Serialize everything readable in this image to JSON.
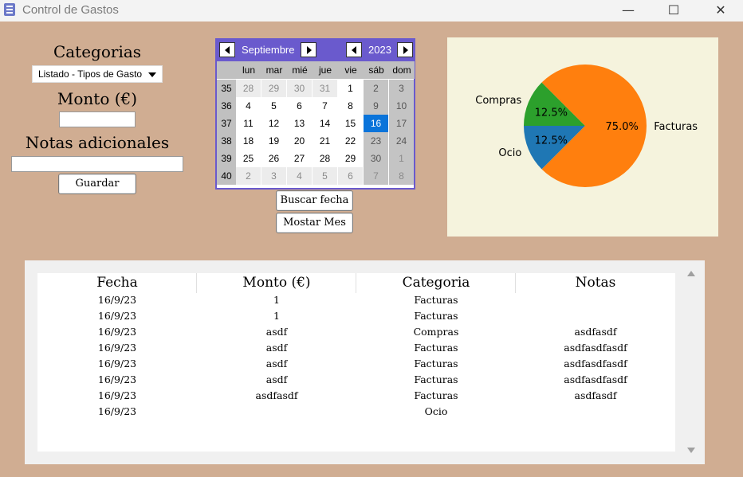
{
  "window": {
    "title": "Control de Gastos",
    "minimize": "—",
    "maximize": "☐",
    "close": "✕"
  },
  "form": {
    "category_label": "Categorias",
    "category_select": "Listado - Tipos de Gasto",
    "amount_label": "Monto (€)",
    "amount_value": "",
    "notes_label": "Notas adicionales",
    "notes_value": "",
    "save_button": "Guardar"
  },
  "calendar": {
    "month": "Septiembre",
    "year": "2023",
    "weekdays": [
      "lun",
      "mar",
      "mié",
      "jue",
      "vie",
      "sáb",
      "dom"
    ],
    "weeks": [
      {
        "num": "35",
        "days": [
          "28",
          "29",
          "30",
          "31",
          "1",
          "2",
          "3"
        ]
      },
      {
        "num": "36",
        "days": [
          "4",
          "5",
          "6",
          "7",
          "8",
          "9",
          "10"
        ]
      },
      {
        "num": "37",
        "days": [
          "11",
          "12",
          "13",
          "14",
          "15",
          "16",
          "17"
        ]
      },
      {
        "num": "38",
        "days": [
          "18",
          "19",
          "20",
          "21",
          "22",
          "23",
          "24"
        ]
      },
      {
        "num": "39",
        "days": [
          "25",
          "26",
          "27",
          "28",
          "29",
          "30",
          "1"
        ]
      },
      {
        "num": "40",
        "days": [
          "2",
          "3",
          "4",
          "5",
          "6",
          "7",
          "8"
        ]
      }
    ],
    "selected_day": "16",
    "search_button": "Buscar fecha",
    "month_button": "Mostar Mes"
  },
  "chart_data": {
    "type": "pie",
    "slices": [
      {
        "label": "Facturas",
        "percent": 75.0,
        "pct_label": "75.0%",
        "color": "#ff7f0e"
      },
      {
        "label": "Ocio",
        "percent": 12.5,
        "pct_label": "12.5%",
        "color": "#1f77b4"
      },
      {
        "label": "Compras",
        "percent": 12.5,
        "pct_label": "12.5%",
        "color": "#2ca02c"
      }
    ]
  },
  "table": {
    "columns": [
      "Fecha",
      "Monto (€)",
      "Categoria",
      "Notas"
    ],
    "rows": [
      [
        "16/9/23",
        "1",
        "Facturas",
        ""
      ],
      [
        "16/9/23",
        "1",
        "Facturas",
        ""
      ],
      [
        "16/9/23",
        "asdf",
        "Compras",
        "asdfasdf"
      ],
      [
        "16/9/23",
        "asdf",
        "Facturas",
        "asdfasdfasdf"
      ],
      [
        "16/9/23",
        "asdf",
        "Facturas",
        "asdfasdfasdf"
      ],
      [
        "16/9/23",
        "asdf",
        "Facturas",
        "asdfasdfasdf"
      ],
      [
        "16/9/23",
        "asdfasdf",
        "Facturas",
        "asdfasdf"
      ],
      [
        "16/9/23",
        "",
        "Ocio",
        ""
      ]
    ]
  }
}
